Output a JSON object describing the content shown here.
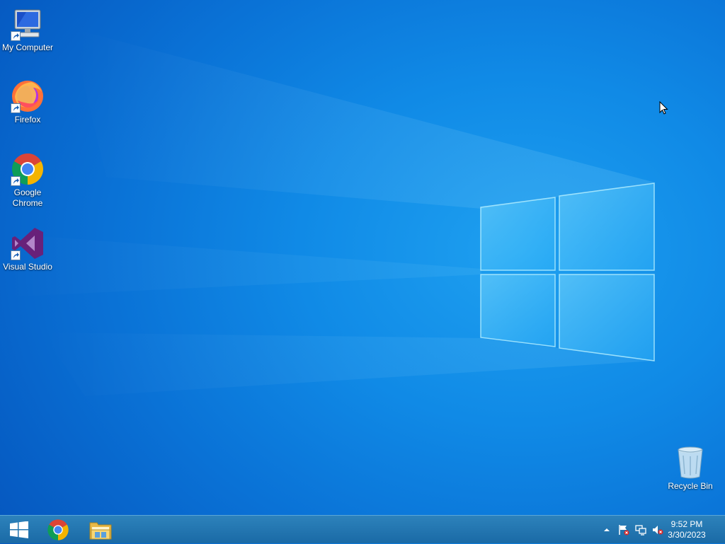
{
  "desktop": {
    "icons": [
      {
        "label": "My Computer",
        "icon": "computer-icon"
      },
      {
        "label": "Firefox",
        "icon": "firefox-icon"
      },
      {
        "label": "Google Chrome",
        "icon": "chrome-icon"
      },
      {
        "label": "Visual Studio",
        "icon": "visual-studio-icon"
      }
    ],
    "recycle_bin": {
      "label": "Recycle Bin",
      "icon": "recycle-bin-icon"
    }
  },
  "taskbar": {
    "start": {
      "icon": "windows-start-icon"
    },
    "pinned": [
      {
        "icon": "chrome-icon"
      },
      {
        "icon": "file-explorer-icon"
      }
    ],
    "tray": {
      "icons": [
        "show-hidden-icons-chevron",
        "action-center-flag-icon",
        "network-icon",
        "volume-muted-icon"
      ],
      "time": "9:52 PM",
      "date": "3/30/2023"
    }
  },
  "colors": {
    "wallpaper": "#108ae6",
    "taskbar": "#2477b2"
  }
}
